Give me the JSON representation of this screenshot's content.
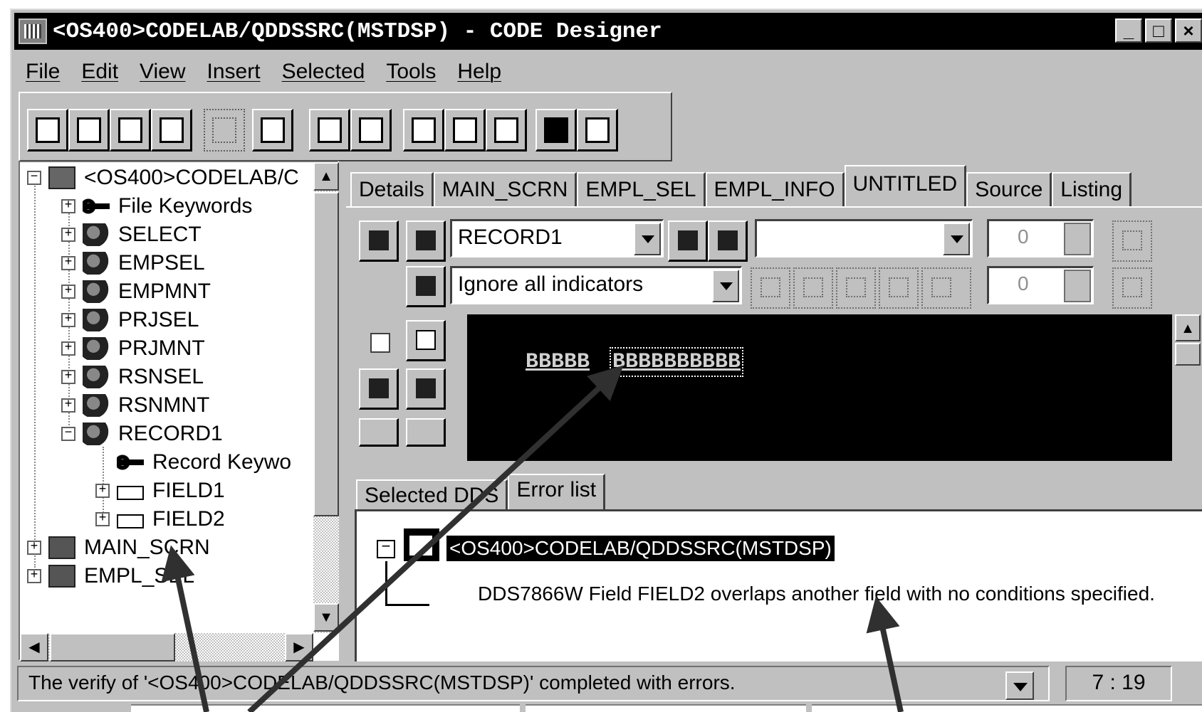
{
  "window": {
    "title": "<OS400>CODELAB/QDDSSRC(MSTDSP) - CODE Designer",
    "controls": [
      "_",
      "□",
      "×"
    ]
  },
  "menu": [
    "File",
    "Edit",
    "View",
    "Insert",
    "Selected",
    "Tools",
    "Help"
  ],
  "tree": {
    "root_label": "<OS400>CODELAB/C",
    "items": [
      {
        "label": "File Keywords",
        "icon": "key-icon"
      },
      {
        "label": "SELECT",
        "icon": "record-icon"
      },
      {
        "label": "EMPSEL",
        "icon": "record-icon"
      },
      {
        "label": "EMPMNT",
        "icon": "record-icon"
      },
      {
        "label": "PRJSEL",
        "icon": "record-icon"
      },
      {
        "label": "PRJMNT",
        "icon": "record-icon"
      },
      {
        "label": "RSNSEL",
        "icon": "record-icon"
      },
      {
        "label": "RSNMNT",
        "icon": "record-icon"
      },
      {
        "label": "RECORD1",
        "icon": "record-error-icon"
      },
      {
        "label": "Record Keywo",
        "icon": "key-icon"
      },
      {
        "label": "FIELD1",
        "icon": "field-icon"
      },
      {
        "label": "FIELD2",
        "icon": "field-error-icon"
      },
      {
        "label": "MAIN_SCRN",
        "icon": "screen-icon"
      },
      {
        "label": "EMPL_SEL",
        "icon": "screen-icon"
      }
    ]
  },
  "tabs": [
    "Details",
    "MAIN_SCRN",
    "EMPL_SEL",
    "EMPL_INFO",
    "UNTITLED",
    "Source",
    "Listing"
  ],
  "active_tab": "UNTITLED",
  "designer": {
    "record_select": "RECORD1",
    "second_select": "",
    "indicator_select": "Ignore all indicators",
    "spin_row": "0",
    "spin_col": "0",
    "field1_text": "BBBBB",
    "field2_text": "BBBBBBBBBB"
  },
  "bottom_tabs": [
    "Selected DDS",
    "Error list"
  ],
  "active_bottom_tab": "Error list",
  "errors": {
    "root": "<OS400>CODELAB/QDDSSRC(MSTDSP)",
    "message": "DDS7866W Field FIELD2 overlaps another field with no conditions specified."
  },
  "status": {
    "text": "The verify of '<OS400>CODELAB/QDDSSRC(MSTDSP)' completed with errors.",
    "cursor": "7 : 19"
  },
  "colors": {
    "chrome": "#c0c0c0",
    "titlebar": "#000000",
    "canvas": "#000000"
  }
}
